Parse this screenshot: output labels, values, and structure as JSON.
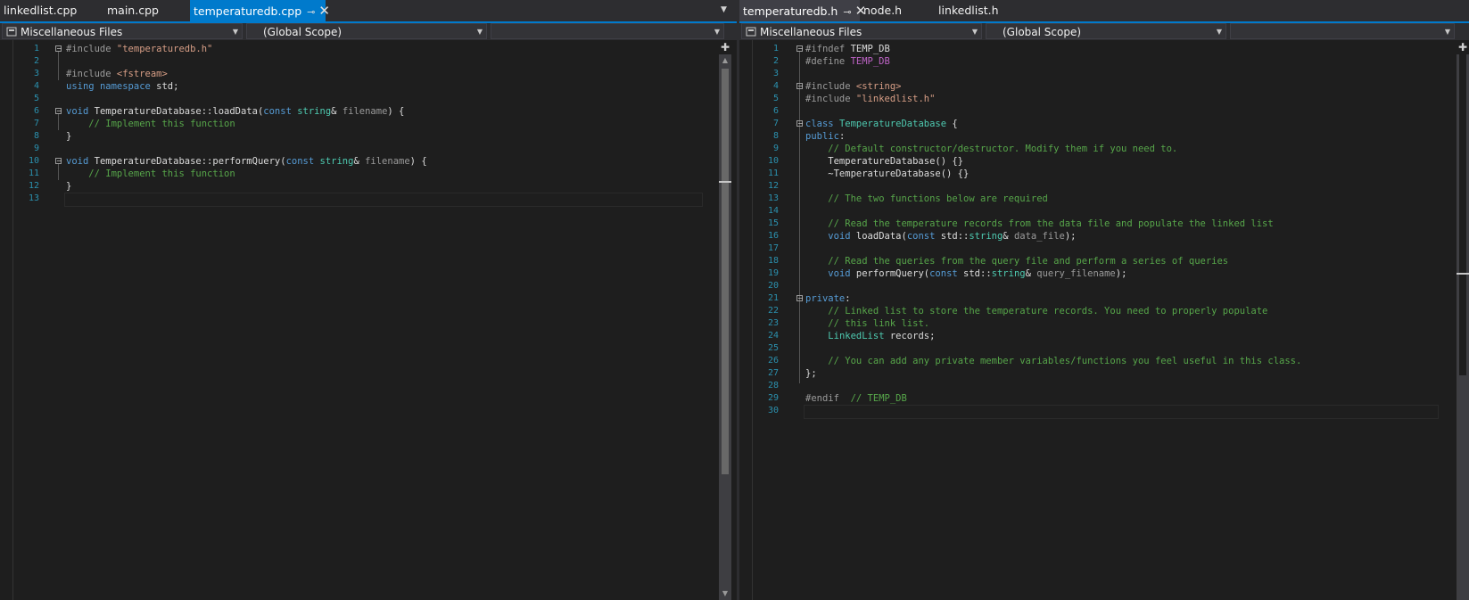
{
  "left": {
    "tabs": [
      {
        "label": "linkedlist.cpp",
        "state": "inactive"
      },
      {
        "label": "main.cpp",
        "state": "inactive"
      },
      {
        "label": "temperaturedb.cpp",
        "state": "active",
        "pinned": true
      }
    ],
    "nav": {
      "project": "Miscellaneous Files",
      "scope": "(Global Scope)",
      "member": ""
    },
    "line_numbers": [
      "1",
      "2",
      "3",
      "4",
      "5",
      "6",
      "7",
      "8",
      "9",
      "10",
      "11",
      "12",
      "13"
    ],
    "code": [
      [
        [
          "pp",
          "#include "
        ],
        [
          "str",
          "\"temperaturedb.h\""
        ]
      ],
      [],
      [
        [
          "pp",
          "#include "
        ],
        [
          "str",
          "<fstream>"
        ]
      ],
      [
        [
          "kw",
          "using"
        ],
        [
          "tx",
          " "
        ],
        [
          "kw",
          "namespace"
        ],
        [
          "tx",
          " std;"
        ]
      ],
      [],
      [
        [
          "kw",
          "void"
        ],
        [
          "tx",
          " "
        ],
        [
          "tx",
          "TemperatureDatabase::loadData("
        ],
        [
          "kw",
          "const"
        ],
        [
          "tx",
          " "
        ],
        [
          "ty",
          "string"
        ],
        [
          "tx",
          "& "
        ],
        [
          "par",
          "filename"
        ],
        [
          "tx",
          ") {"
        ]
      ],
      [
        [
          "tx",
          "    "
        ],
        [
          "com",
          "// Implement this function"
        ]
      ],
      [
        [
          "tx",
          "}"
        ]
      ],
      [],
      [
        [
          "kw",
          "void"
        ],
        [
          "tx",
          " "
        ],
        [
          "tx",
          "TemperatureDatabase::performQuery("
        ],
        [
          "kw",
          "const"
        ],
        [
          "tx",
          " "
        ],
        [
          "ty",
          "string"
        ],
        [
          "tx",
          "& "
        ],
        [
          "par",
          "filename"
        ],
        [
          "tx",
          ") {"
        ]
      ],
      [
        [
          "tx",
          "    "
        ],
        [
          "com",
          "// Implement this function"
        ]
      ],
      [
        [
          "tx",
          "}"
        ]
      ],
      []
    ]
  },
  "right": {
    "tabs": [
      {
        "label": "temperaturedb.h",
        "state": "preview-active",
        "pinned": true
      },
      {
        "label": "node.h",
        "state": "inactive"
      },
      {
        "label": "linkedlist.h",
        "state": "inactive"
      }
    ],
    "nav": {
      "project": "Miscellaneous Files",
      "scope": "(Global Scope)",
      "member": ""
    },
    "line_numbers": [
      "1",
      "2",
      "3",
      "4",
      "5",
      "6",
      "7",
      "8",
      "9",
      "10",
      "11",
      "12",
      "13",
      "14",
      "15",
      "16",
      "17",
      "18",
      "19",
      "20",
      "21",
      "22",
      "23",
      "24",
      "25",
      "26",
      "27",
      "28",
      "29",
      "30"
    ],
    "code": [
      [
        [
          "pp",
          "#ifndef "
        ],
        [
          "tx",
          "TEMP_DB"
        ]
      ],
      [
        [
          "pp",
          "#define "
        ],
        [
          "mac",
          "TEMP_DB"
        ]
      ],
      [],
      [
        [
          "pp",
          "#include "
        ],
        [
          "str",
          "<string>"
        ]
      ],
      [
        [
          "pp",
          "#include "
        ],
        [
          "str",
          "\"linkedlist.h\""
        ]
      ],
      [],
      [
        [
          "kw",
          "class"
        ],
        [
          "tx",
          " "
        ],
        [
          "ty",
          "TemperatureDatabase"
        ],
        [
          "tx",
          " {"
        ]
      ],
      [
        [
          "kw",
          "public"
        ],
        [
          "tx",
          ":"
        ]
      ],
      [
        [
          "tx",
          "    "
        ],
        [
          "com",
          "// Default constructor/destructor. Modify them if you need to."
        ]
      ],
      [
        [
          "tx",
          "    TemperatureDatabase() {}"
        ]
      ],
      [
        [
          "tx",
          "    ~TemperatureDatabase() {}"
        ]
      ],
      [],
      [
        [
          "tx",
          "    "
        ],
        [
          "com",
          "// The two functions below are required"
        ]
      ],
      [],
      [
        [
          "tx",
          "    "
        ],
        [
          "com",
          "// Read the temperature records from the data file and populate the linked list"
        ]
      ],
      [
        [
          "tx",
          "    "
        ],
        [
          "kw",
          "void"
        ],
        [
          "tx",
          " loadData("
        ],
        [
          "kw",
          "const"
        ],
        [
          "tx",
          " std::"
        ],
        [
          "ty",
          "string"
        ],
        [
          "tx",
          "& "
        ],
        [
          "par",
          "data_file"
        ],
        [
          "tx",
          ");"
        ]
      ],
      [],
      [
        [
          "tx",
          "    "
        ],
        [
          "com",
          "// Read the queries from the query file and perform a series of queries"
        ]
      ],
      [
        [
          "tx",
          "    "
        ],
        [
          "kw",
          "void"
        ],
        [
          "tx",
          " performQuery("
        ],
        [
          "kw",
          "const"
        ],
        [
          "tx",
          " std::"
        ],
        [
          "ty",
          "string"
        ],
        [
          "tx",
          "& "
        ],
        [
          "par",
          "query_filename"
        ],
        [
          "tx",
          ");"
        ]
      ],
      [],
      [
        [
          "kw",
          "private"
        ],
        [
          "tx",
          ":"
        ]
      ],
      [
        [
          "tx",
          "    "
        ],
        [
          "com",
          "// Linked list to store the temperature records. You need to properly populate"
        ]
      ],
      [
        [
          "tx",
          "    "
        ],
        [
          "com",
          "// this link list."
        ]
      ],
      [
        [
          "tx",
          "    "
        ],
        [
          "ty",
          "LinkedList"
        ],
        [
          "tx",
          " records;"
        ]
      ],
      [],
      [
        [
          "tx",
          "    "
        ],
        [
          "com",
          "// You can add any private member variables/functions you feel useful in this class."
        ]
      ],
      [
        [
          "tx",
          "};"
        ]
      ],
      [],
      [
        [
          "pp",
          "#endif"
        ],
        [
          "tx",
          "  "
        ],
        [
          "com",
          "// TEMP_DB"
        ]
      ],
      []
    ]
  }
}
